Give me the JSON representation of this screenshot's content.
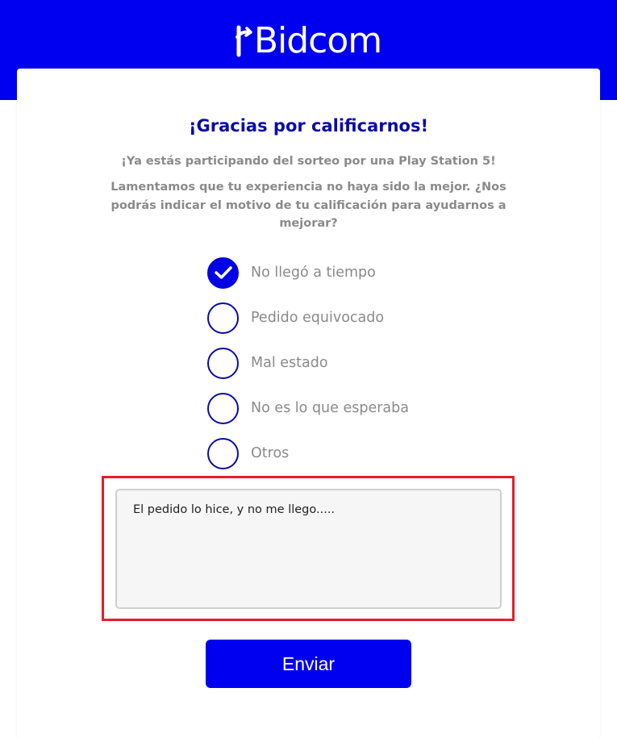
{
  "brand": {
    "name": "Bidcom",
    "logo_text": "Bidcom",
    "primary_color": "#0000f0",
    "title_color": "#0a0aa8",
    "highlight_color": "#e0202a"
  },
  "header": {
    "title": "¡Gracias por calificarnos!",
    "subtitle": "¡Ya estás participando del sorteo por una Play Station 5!",
    "question": "Lamentamos que tu experiencia no haya sido la mejor. ¿Nos podrás indicar el motivo de tu calificación para ayudarnos a mejorar?"
  },
  "options": [
    {
      "label": "No llegó a tiempo",
      "checked": true
    },
    {
      "label": "Pedido equivocado",
      "checked": false
    },
    {
      "label": "Mal estado",
      "checked": false
    },
    {
      "label": "No es lo que esperaba",
      "checked": false
    },
    {
      "label": "Otros",
      "checked": false
    }
  ],
  "comment": {
    "value": "El pedido lo hice, y no me llego....."
  },
  "submit": {
    "label": "Enviar"
  },
  "icons": {
    "check": "check-icon",
    "logo_mark": "bidcom-logo-mark-icon"
  }
}
